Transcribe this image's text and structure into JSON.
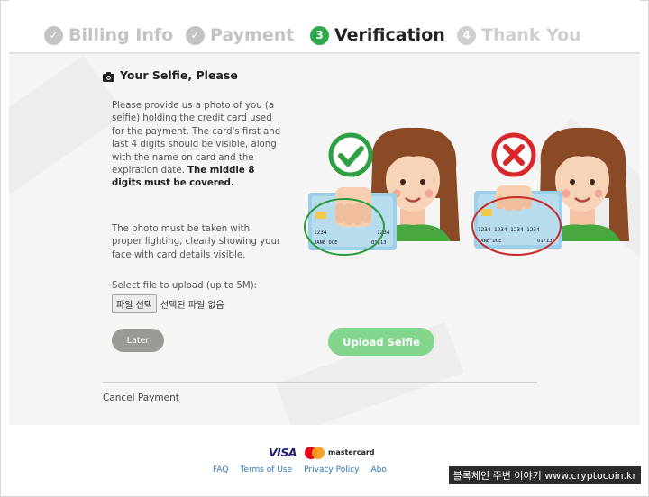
{
  "steps": [
    {
      "number": "✓",
      "label": "Billing Info",
      "state": "done"
    },
    {
      "number": "✓",
      "label": "Payment",
      "state": "done"
    },
    {
      "number": "3",
      "label": "Verification",
      "state": "active"
    },
    {
      "number": "4",
      "label": "Thank You",
      "state": "todo"
    }
  ],
  "section": {
    "title": "Your Selfie, Please",
    "icon": "camera-icon",
    "description": "Please provide us a photo of you (a selfie) holding the credit card used for the payment. The card's first and last 4 digits should be visible, along with the name on card and the expiration date.",
    "description_bold": "The middle 8 digits must be covered.",
    "lighting": "The photo must be taken with proper lighting, clearly showing your face with card details visible."
  },
  "upload": {
    "label": "Select file to upload (up to 5M):",
    "file_button": "파일 선택",
    "file_status": "선택된 파일 없음"
  },
  "buttons": {
    "later": "Later",
    "upload": "Upload Selfie",
    "cancel": "Cancel Payment"
  },
  "illustration": {
    "good_card": {
      "number": "1234",
      "number_end": "1234",
      "name": "JANE DOE",
      "expiry": "01/13"
    },
    "bad_card": {
      "number": "1234 1234 1234 1234",
      "name": "JANE DOE",
      "expiry": "01/13"
    }
  },
  "footer": {
    "visa": "VISA",
    "mastercard": "mastercard",
    "links": [
      "FAQ",
      "Terms of Use",
      "Privacy Policy",
      "Abo"
    ],
    "watermark": "블록체인 주변 이야기 www.cryptocoin.kr"
  },
  "colors": {
    "accent": "#2eaa4a",
    "upload_button": "#82d58a",
    "later_button": "#9a9a95",
    "error_red": "#d9262b"
  }
}
